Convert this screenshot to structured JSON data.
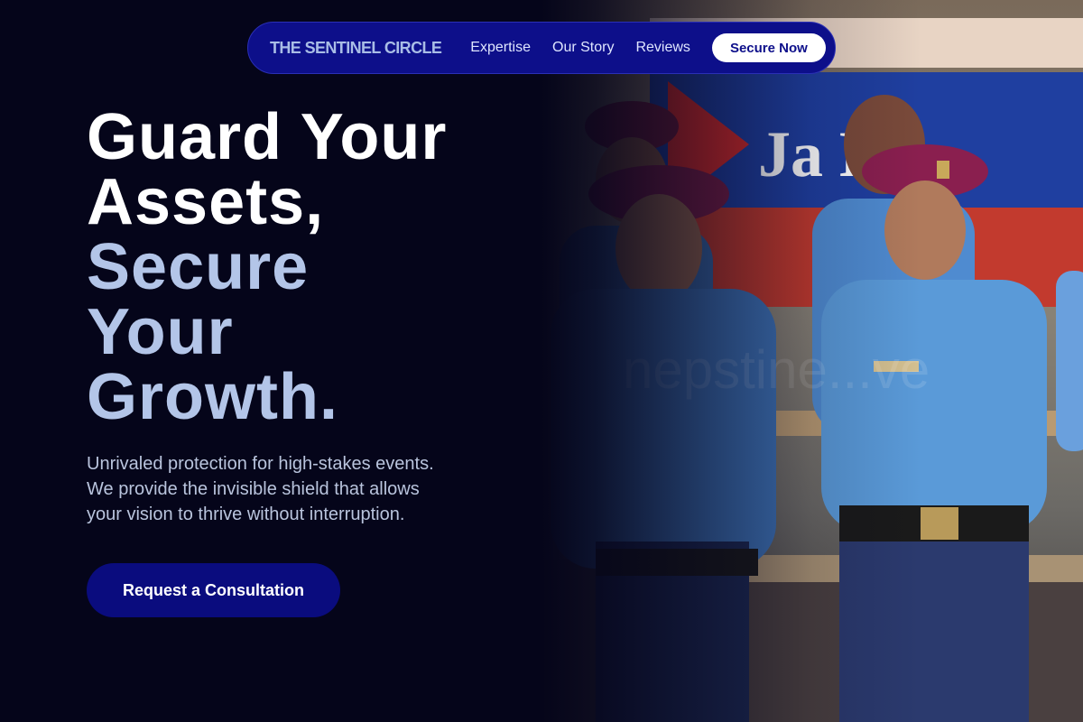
{
  "nav": {
    "brand": "THE SENTINEL CIRCLE",
    "links": [
      "Expertise",
      "Our Story",
      "Reviews"
    ],
    "cta_label": "Secure Now"
  },
  "hero": {
    "headline_white": [
      "Guard Your",
      "Assets,"
    ],
    "headline_muted": [
      "Secure",
      "Your",
      "Growth."
    ],
    "subtext": "Unrivaled protection for high-stakes events. We provide the invisible shield that allows your vision to thrive without interruption.",
    "cta_label": "Request a Consultation",
    "image_banner_text": "Ja  Ba",
    "image_watermark": "nepstine...ve"
  },
  "colors": {
    "background": "#05051a",
    "nav_bg": "#0d0f8a",
    "brand_text": "#a9bde6",
    "headline_muted": "#b3c5e8",
    "cta_bg": "#0a0c7e"
  }
}
